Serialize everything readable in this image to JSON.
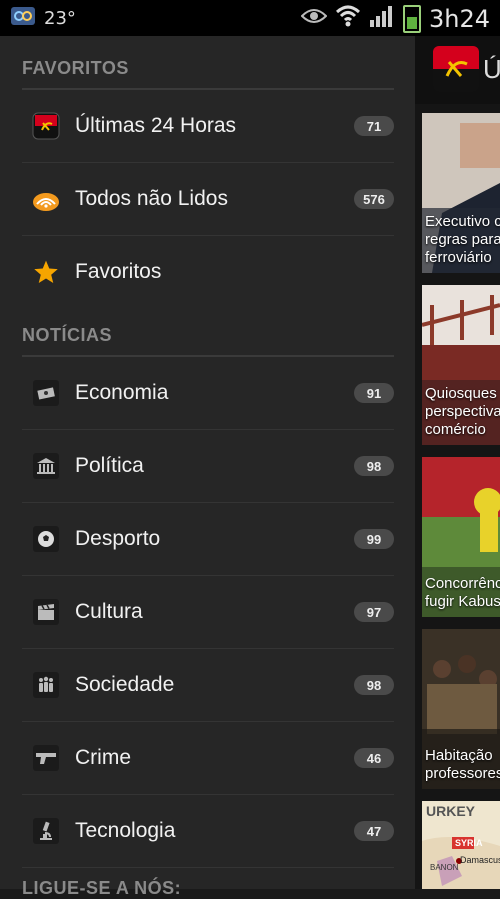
{
  "status": {
    "temp": "23°",
    "time": "3h24"
  },
  "sections": {
    "favoritos": "FAVORITOS",
    "noticias": "NOTÍCIAS",
    "ligue": "LIGUE-SE A NÓS:"
  },
  "favorites": [
    {
      "label": "Últimas 24 Horas",
      "count": "71"
    },
    {
      "label": "Todos não Lidos",
      "count": "576"
    },
    {
      "label": "Favoritos"
    }
  ],
  "categories": [
    {
      "label": "Economia",
      "count": "91",
      "icon": "money-icon"
    },
    {
      "label": "Política",
      "count": "98",
      "icon": "building-icon"
    },
    {
      "label": "Desporto",
      "count": "99",
      "icon": "soccer-ball-icon"
    },
    {
      "label": "Cultura",
      "count": "97",
      "icon": "clapperboard-icon"
    },
    {
      "label": "Sociedade",
      "count": "98",
      "icon": "people-icon"
    },
    {
      "label": "Crime",
      "count": "46",
      "icon": "gun-icon"
    },
    {
      "label": "Tecnologia",
      "count": "47",
      "icon": "microscope-icon"
    }
  ],
  "right_panel": {
    "title": "Ú",
    "news": [
      {
        "line1": "Executivo c",
        "line2": "regras para",
        "line3": "ferroviário"
      },
      {
        "line1": "Quiosques",
        "line2": "perspectiva",
        "line3": "comércio"
      },
      {
        "line1": "Concorrênc",
        "line2": "fugir Kabus",
        "line3": ""
      },
      {
        "line1": "Habitação",
        "line2": "professores",
        "line3": ""
      },
      {
        "line1": "",
        "line2": "",
        "line3": ""
      }
    ],
    "map_labels": {
      "turkey": "URKEY",
      "syria": "SYRIA",
      "damascus": "Damascus",
      "lebanon": "BANON"
    }
  },
  "colors": {
    "drawer_bg": "#262626",
    "accent_red": "#d4001c",
    "star": "#f6a500"
  }
}
